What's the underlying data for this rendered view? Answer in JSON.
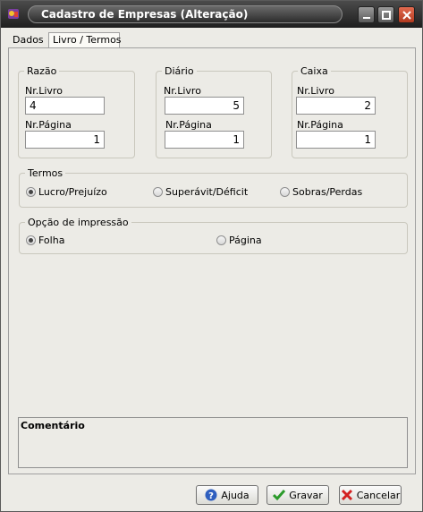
{
  "window": {
    "title": "Cadastro de Empresas (Alteração)"
  },
  "tabs": [
    {
      "label": "Dados"
    },
    {
      "label": "Livro / Termos"
    }
  ],
  "groups": {
    "razao": {
      "title": "Razão",
      "livro_label": "Nr.Livro",
      "livro_value": "4",
      "pagina_label": "Nr.Página",
      "pagina_value": "1"
    },
    "diario": {
      "title": "Diário",
      "livro_label": "Nr.Livro",
      "livro_value": "5",
      "pagina_label": "Nr.Página",
      "pagina_value": "1"
    },
    "caixa": {
      "title": "Caixa",
      "livro_label": "Nr.Livro",
      "livro_value": "2",
      "pagina_label": "Nr.Página",
      "pagina_value": "1"
    }
  },
  "termos": {
    "title": "Termos",
    "options": [
      "Lucro/Prejuízo",
      "Superávit/Déficit",
      "Sobras/Perdas"
    ],
    "selected": "Lucro/Prejuízo"
  },
  "impressao": {
    "title": "Opção de impressão",
    "options": [
      "Folha",
      "Página"
    ],
    "selected": "Folha"
  },
  "comentario": {
    "label": "Comentário"
  },
  "buttons": {
    "ajuda": "Ajuda",
    "gravar": "Gravar",
    "cancelar": "Cancelar"
  },
  "colors": {
    "titlebar": "#2b2b2b",
    "close": "#d9532f",
    "surface": "#ecebe6"
  }
}
